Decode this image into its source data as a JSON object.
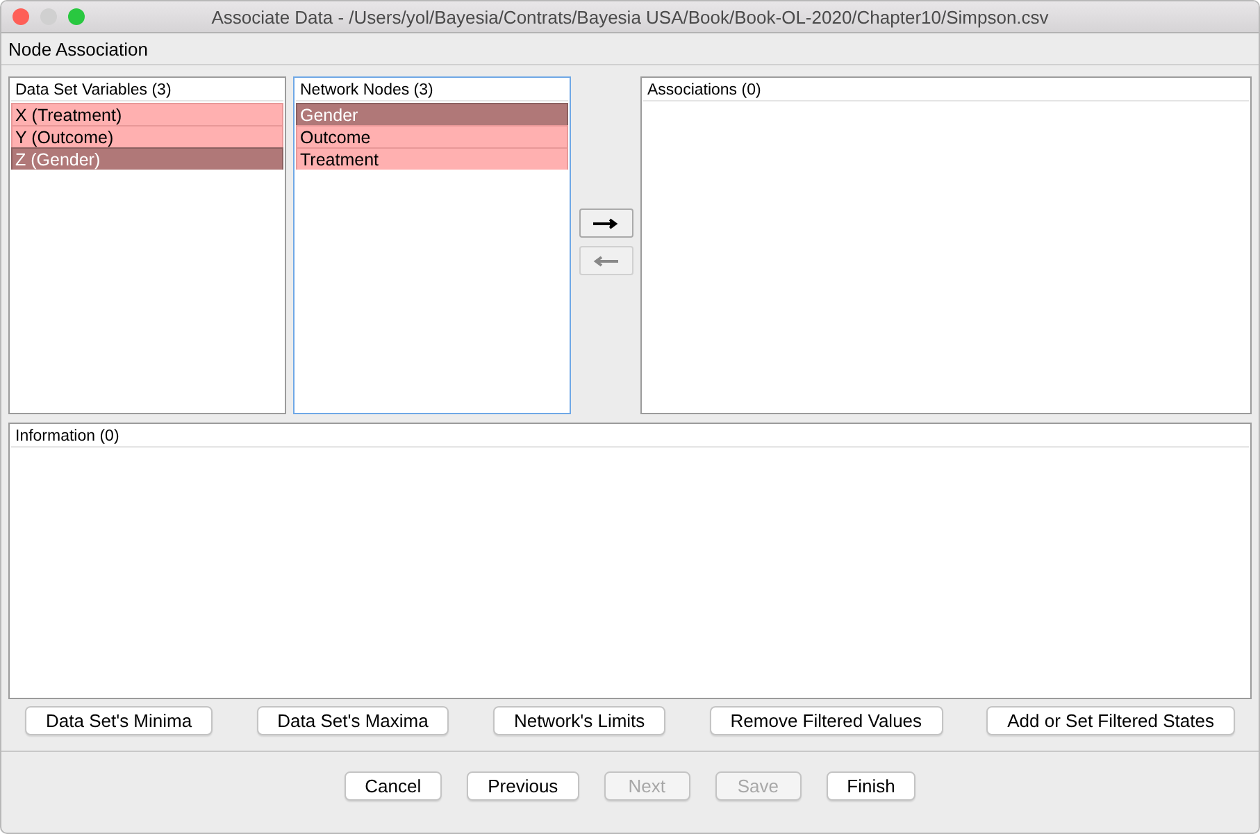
{
  "window": {
    "title": "Associate Data - /Users/yol/Bayesia/Contrats/Bayesia USA/Book/Book-OL-2020/Chapter10/Simpson.csv"
  },
  "section_title": "Node Association",
  "data_set_variables": {
    "header": "Data Set Variables (3)",
    "focused": false,
    "items": [
      {
        "label": "X (Treatment)",
        "selected": false
      },
      {
        "label": "Y (Outcome)",
        "selected": false
      },
      {
        "label": "Z (Gender)",
        "selected": true
      }
    ]
  },
  "network_nodes": {
    "header": "Network Nodes (3)",
    "focused": true,
    "items": [
      {
        "label": "Gender",
        "selected": true
      },
      {
        "label": "Outcome",
        "selected": false
      },
      {
        "label": "Treatment",
        "selected": false
      }
    ]
  },
  "move_buttons": [
    {
      "kind": "right",
      "disabled": false
    },
    {
      "kind": "left",
      "disabled": true
    }
  ],
  "associations": {
    "header": "Associations (0)"
  },
  "information": {
    "header": "Information (0)"
  },
  "filter_buttons": [
    {
      "label": "Data Set's Minima"
    },
    {
      "label": "Data Set's Maxima"
    },
    {
      "label": "Network's Limits"
    },
    {
      "label": "Remove Filtered Values"
    },
    {
      "label": "Add or Set Filtered States"
    }
  ],
  "footer_buttons": [
    {
      "label": "Cancel",
      "disabled": false
    },
    {
      "label": "Previous",
      "disabled": false
    },
    {
      "label": "Next",
      "disabled": true
    },
    {
      "label": "Save",
      "disabled": true
    },
    {
      "label": "Finish",
      "disabled": false
    }
  ]
}
